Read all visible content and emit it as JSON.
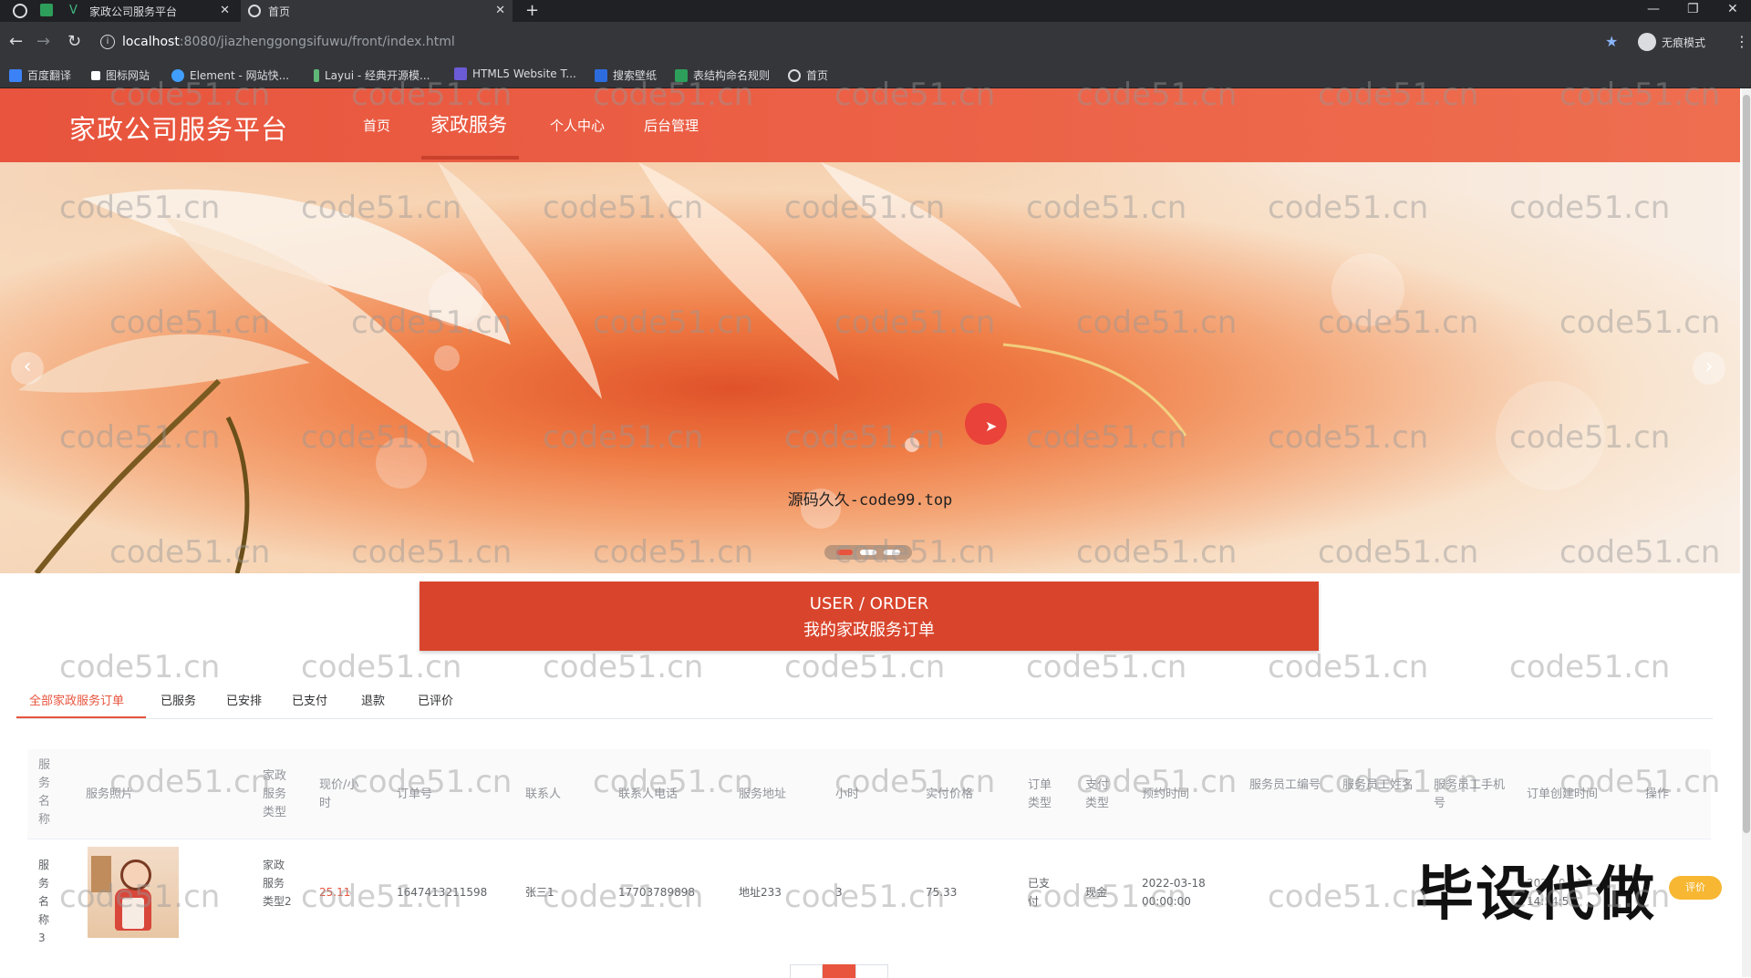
{
  "browser": {
    "tabs": [
      {
        "title": "家政公司服务平台",
        "active": false
      },
      {
        "title": "首页",
        "active": true
      }
    ],
    "new_tab": "+",
    "url_host": "localhost",
    "url_path": ":8080/jiazhenggongsifuwu/front/index.html",
    "profile_label": "无痕模式",
    "bookmarks": [
      "百度翻译",
      "图标网站",
      "Element - 网站快...",
      "Layui - 经典开源模...",
      "HTML5 Website T...",
      "搜索壁纸",
      "表结构命名规则",
      "首页"
    ]
  },
  "header": {
    "brand": "家政公司服务平台",
    "nav": [
      "首页",
      "家政服务",
      "个人中心",
      "后台管理"
    ],
    "active_nav": "家政服务"
  },
  "banner": {
    "caption": "源码久久-code99.top",
    "slide_count": 3,
    "active_slide": 1
  },
  "order_section": {
    "title_en": "USER / ORDER",
    "title_zh": "我的家政服务订单"
  },
  "order_tabs": [
    "全部家政服务订单",
    "已服务",
    "已安排",
    "已支付",
    "退款",
    "已评价"
  ],
  "table": {
    "headers": [
      "服务名称",
      "服务照片",
      "家政服务类型",
      "现价/小时",
      "订单号",
      "联系人",
      "联系人电话",
      "服务地址",
      "小时",
      "实付价格",
      "订单类型",
      "支付类型",
      "预约时间",
      "服务员工编号",
      "服务员工姓名",
      "服务员工手机号",
      "订单创建时间",
      "操作"
    ],
    "rows": [
      {
        "name": "服务名称3",
        "type": "家政服务类型2",
        "price": "25.11",
        "order_no": "1647413211598",
        "contact": "张三1",
        "phone": "17703789898",
        "address": "地址233",
        "hours": "3",
        "paid": "75.33",
        "order_type": "已支付",
        "pay_type": "现金",
        "appointment": "2022-03-18 00:00:00",
        "created_partial": "2022-03-16 14:54:5",
        "action": "评价"
      }
    ]
  },
  "overlay_text": "毕设代做",
  "watermark": "code51.cn",
  "colors": {
    "accent": "#e8543d",
    "order_bar": "#d9452c",
    "button": "#f7b733"
  }
}
